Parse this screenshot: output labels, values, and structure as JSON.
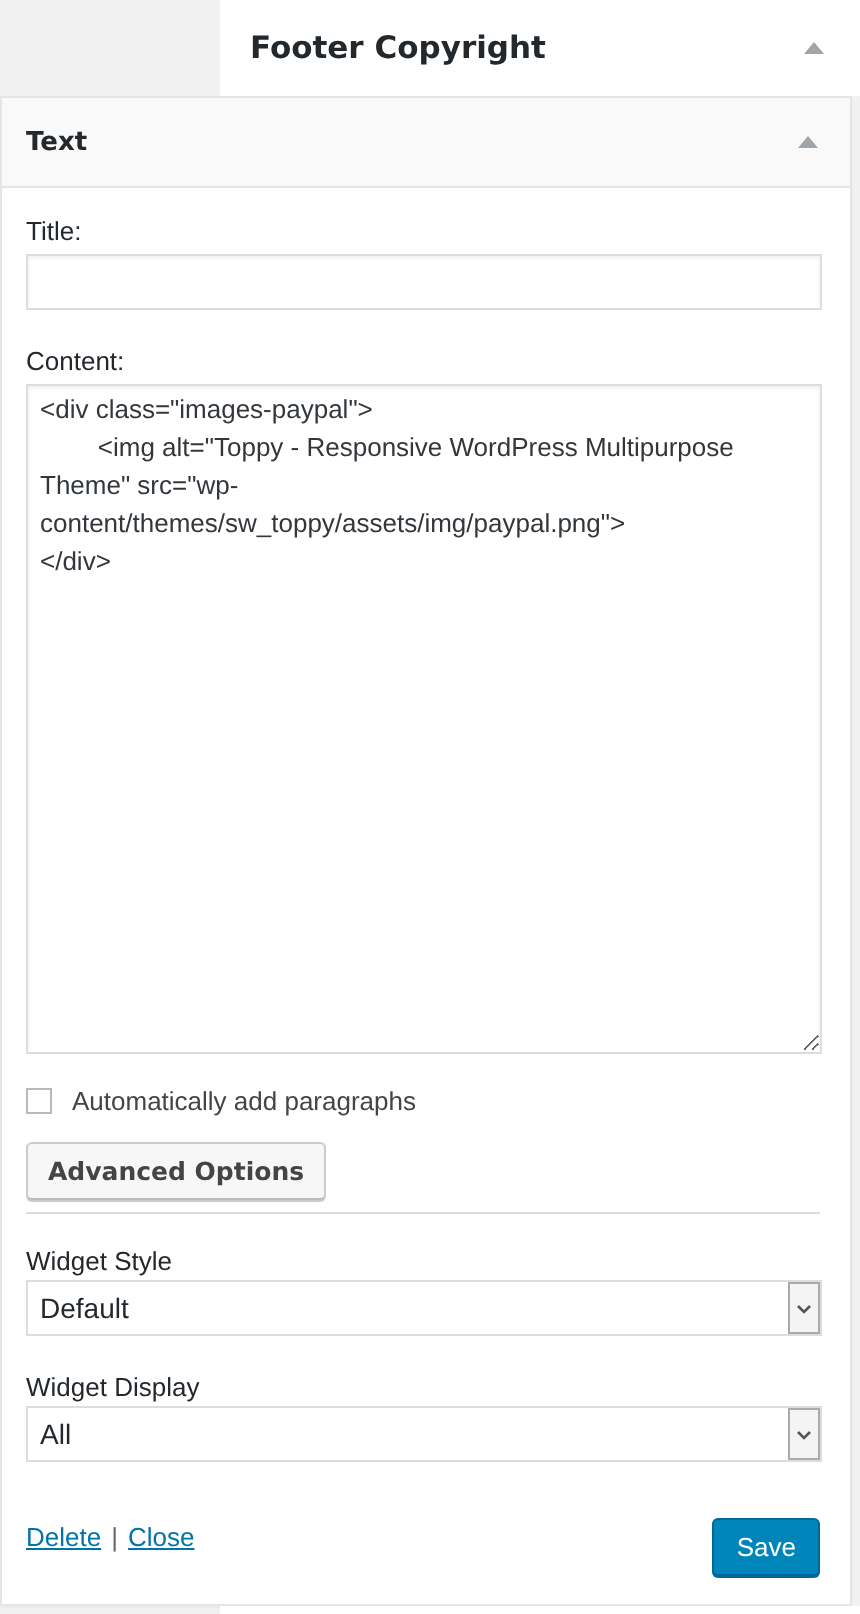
{
  "sidebar_header": {
    "title": "Footer Copyright",
    "expanded": true
  },
  "widget": {
    "title": "Text",
    "expanded": true,
    "fields": [
      {
        "kind": "input",
        "label": "Title:"
      },
      {
        "kind": "textarea",
        "label": "Content:",
        "value": "<div class=\"images-paypal\">\n\t<img alt=\"Toppy - Responsive WordPress Multipurpose Theme\" src=\"wp-content/themes/sw_toppy/assets/img/paypal.png\">\n</div>"
      }
    ],
    "auto_paragraphs": {
      "label": "Automatically add paragraphs",
      "checked": false
    },
    "advanced_button": "Advanced Options",
    "selects": [
      {
        "label": "Widget Style",
        "value": "Default"
      },
      {
        "label": "Widget Display",
        "value": "All"
      }
    ],
    "links": [
      "Delete",
      "Close"
    ],
    "separator": "|",
    "save_button": "Save"
  }
}
